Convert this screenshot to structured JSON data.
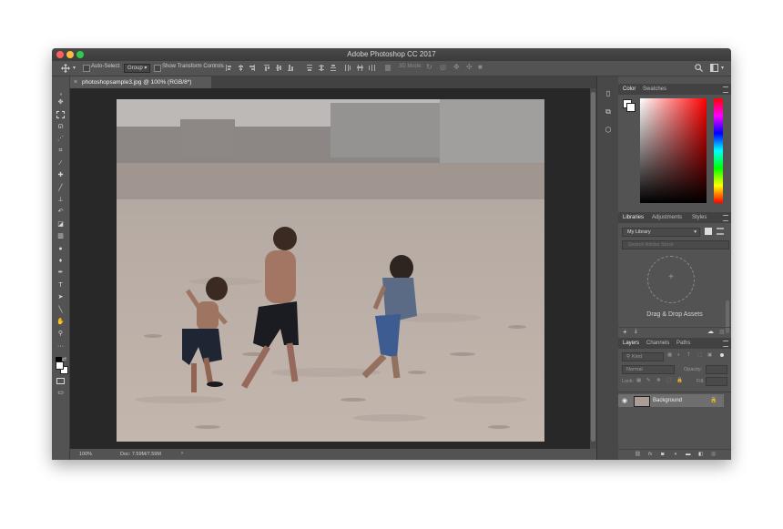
{
  "app": {
    "title": "Adobe Photoshop CC 2017"
  },
  "options_bar": {
    "auto_select_label": "Auto-Select:",
    "auto_select_value": "Group",
    "show_transform_label": "Show Transform Controls",
    "mode_3d_label": "3D Mode:"
  },
  "document": {
    "tab_label": "photoshopsample3.jpg @ 100% (RGB/8*)",
    "zoom": "100%",
    "doc_size": "Doc: 7.59M/7.59M"
  },
  "color_panel": {
    "tabs": [
      "Color",
      "Swatches"
    ],
    "active_tab": "Color",
    "accent_hue": "#ff0000"
  },
  "libraries_panel": {
    "tabs": [
      "Libraries",
      "Adjustments",
      "Styles"
    ],
    "library_name": "My Library",
    "search_placeholder": "Search Adobe Stock",
    "drag_drop_label": "Drag & Drop Assets"
  },
  "layers_panel": {
    "tabs": [
      "Layers",
      "Channels",
      "Paths"
    ],
    "kind_label": "Kind",
    "blend_mode": "Normal",
    "opacity_label": "Opacity:",
    "lock_label": "Lock:",
    "fill_label": "Fill:",
    "layers": [
      {
        "name": "Background",
        "visible": true,
        "locked": true
      }
    ]
  }
}
